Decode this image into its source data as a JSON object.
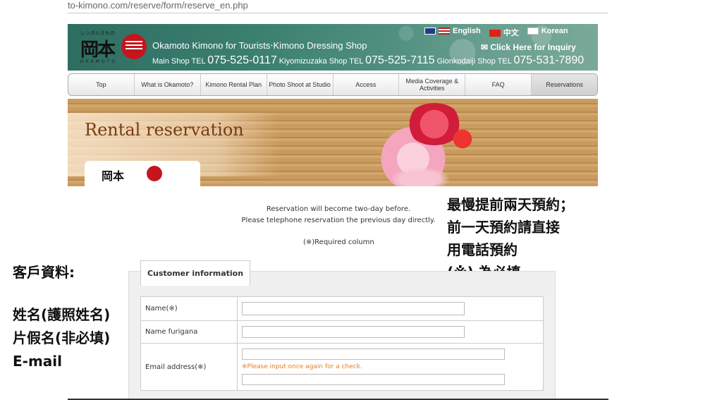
{
  "browser": {
    "url": "to-kimono.com/reserve/form/reserve_en.php"
  },
  "header": {
    "logo_small": "レンタルきもの",
    "logo_kanji": "岡本",
    "logo_sub": "OKAMOTO",
    "shop_name": "Okamoto Kimono for Tourists‧Kimono Dressing Shop",
    "main_label": "Main Shop TEL",
    "main_tel": "075-525-0117",
    "kiyo_label": "Kiyomizuzaka Shop TEL",
    "kiyo_tel": "075-525-7115",
    "gion_label": "Gionkodaiji Shop TEL",
    "gion_tel": "075-531-7890",
    "lang_english": "English",
    "lang_chinese": "中文",
    "lang_korean": "Korean",
    "inquiry": "✉ Click Here for Inquiry"
  },
  "nav": {
    "items": [
      "Top",
      "What is Okamoto?",
      "Kimono Rental Plan",
      "Photo Shoot at Studio",
      "Access",
      "Media Coverage & Activities",
      "FAQ",
      "Reservations"
    ]
  },
  "banner": {
    "title": "Rental reservation",
    "logo": "岡本"
  },
  "notice": {
    "line1": "Reservation will become two-day before.",
    "line2": "Please telephone reservation the previous day directly.",
    "required": "(※)Required column"
  },
  "annotations": {
    "right": [
      "最慢提前兩天預約；",
      "前一天預約請直接",
      "用電話預約",
      "(※) 為必填"
    ],
    "left_title": "客戶資料:",
    "left_items": [
      "姓名(護照姓名)",
      "片假名(非必填)",
      "E-mail"
    ]
  },
  "form": {
    "section_title": "Customer information",
    "name_label": "Name(※)",
    "furigana_label": "Name furigana",
    "email_label": "Email address(※)",
    "email_hint": "※Please input once again for a check."
  }
}
